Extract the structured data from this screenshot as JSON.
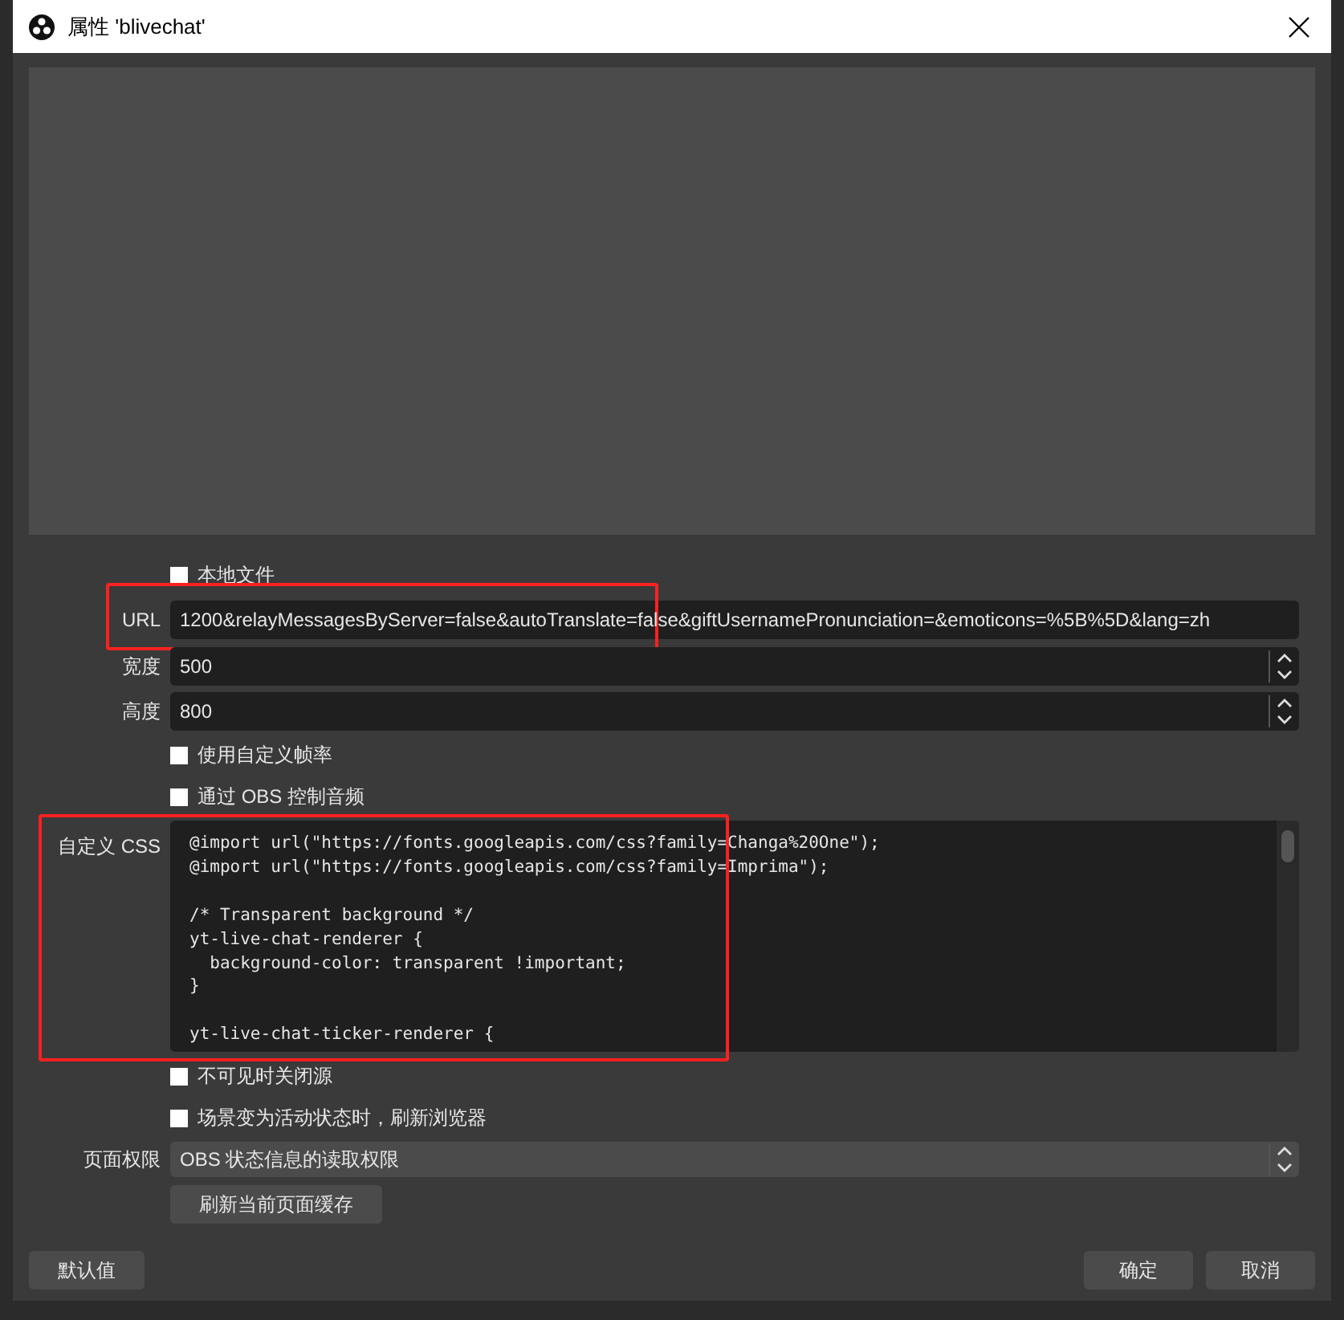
{
  "window": {
    "title": "属性 'blivechat'"
  },
  "local_file": {
    "label": "本地文件",
    "checked": false
  },
  "url": {
    "label": "URL",
    "value": "1200&relayMessagesByServer=false&autoTranslate=false&giftUsernamePronunciation=&emoticons=%5B%5D&lang=zh",
    "highlighted": true
  },
  "width": {
    "label": "宽度",
    "value": "500"
  },
  "height": {
    "label": "高度",
    "value": "800"
  },
  "custom_fps": {
    "label": "使用自定义帧率",
    "checked": false
  },
  "obs_audio": {
    "label": "通过 OBS 控制音频",
    "checked": false
  },
  "custom_css": {
    "label": "自定义 CSS",
    "highlighted": true,
    "blocks": [
      [
        "@import url(\"https://fonts.googleapis.com/css?family=Changa%20One\");",
        "@import url(\"https://fonts.googleapis.com/css?family=Imprima\");"
      ],
      [
        "/* Transparent background */",
        "yt-live-chat-renderer {",
        "  background-color: transparent !important;",
        "}"
      ],
      [
        "yt-live-chat-ticker-renderer {"
      ]
    ]
  },
  "shutdown_hidden": {
    "label": "不可见时关闭源",
    "checked": false
  },
  "refresh_active": {
    "label": "场景变为活动状态时，刷新浏览器",
    "checked": false
  },
  "page_permissions": {
    "label": "页面权限",
    "value": "OBS 状态信息的读取权限"
  },
  "refresh_cache_button": "刷新当前页面缓存",
  "buttons": {
    "defaults": "默认值",
    "ok": "确定",
    "cancel": "取消"
  }
}
